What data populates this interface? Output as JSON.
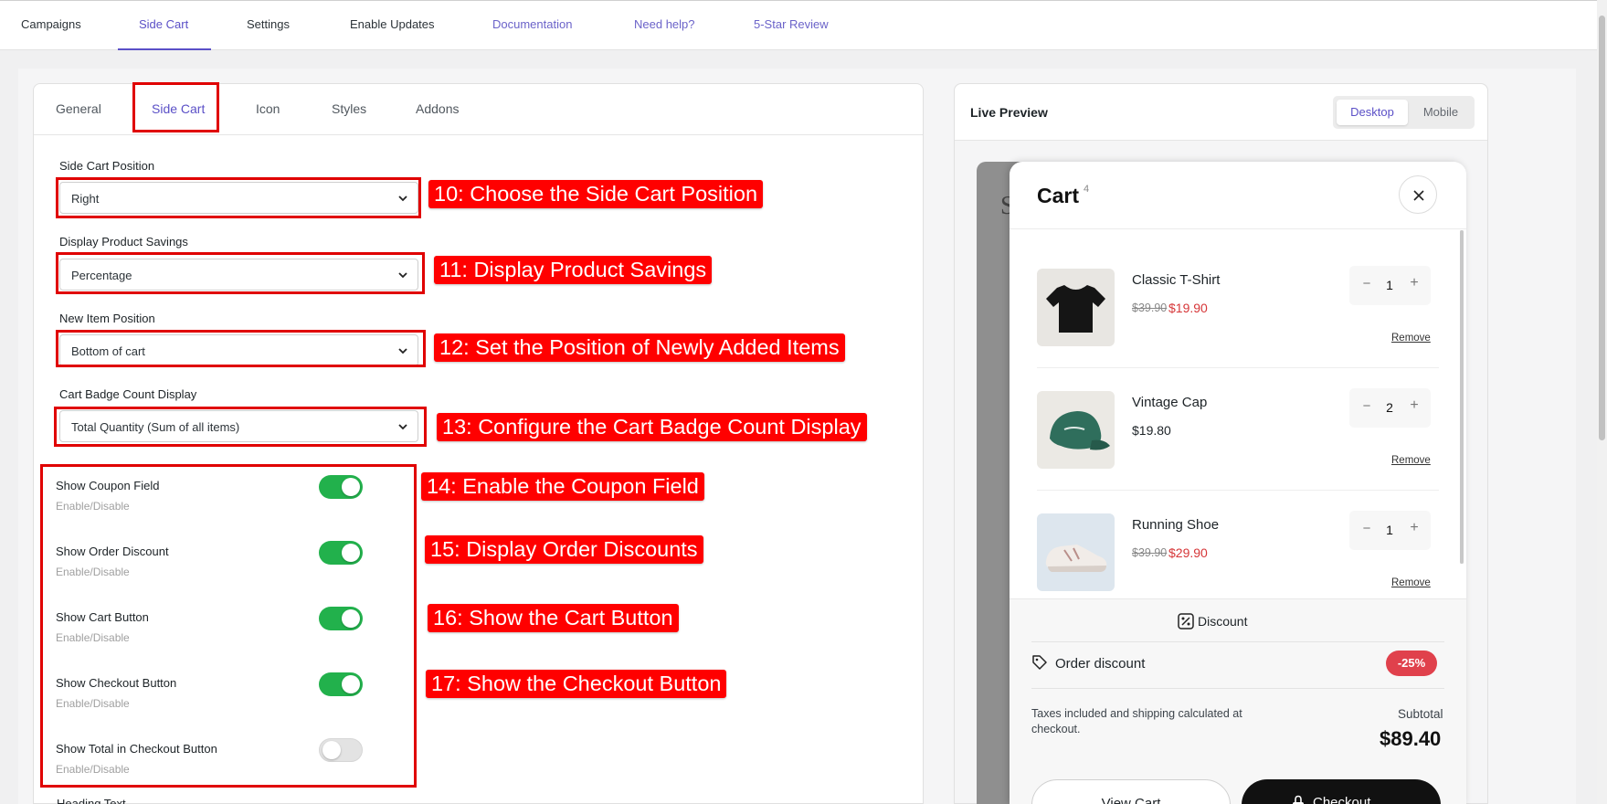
{
  "top_nav": [
    {
      "label": "Campaigns",
      "state": "normal"
    },
    {
      "label": "Side Cart",
      "state": "active"
    },
    {
      "label": "Settings",
      "state": "normal"
    },
    {
      "label": "Enable Updates",
      "state": "normal"
    },
    {
      "label": "Documentation",
      "state": "link"
    },
    {
      "label": "Need help?",
      "state": "link"
    },
    {
      "label": "5-Star Review",
      "state": "link"
    }
  ],
  "tabs": [
    {
      "label": "General"
    },
    {
      "label": "Side Cart",
      "active": true
    },
    {
      "label": "Icon"
    },
    {
      "label": "Styles"
    },
    {
      "label": "Addons"
    }
  ],
  "fields": {
    "position": {
      "label": "Side Cart Position",
      "value": "Right"
    },
    "savings": {
      "label": "Display Product Savings",
      "value": "Percentage"
    },
    "new_item": {
      "label": "New Item Position",
      "value": "Bottom of cart"
    },
    "badge": {
      "label": "Cart Badge Count Display",
      "value": "Total Quantity (Sum of all items)"
    }
  },
  "toggles": [
    {
      "label": "Show Coupon Field",
      "sub": "Enable/Disable",
      "on": true
    },
    {
      "label": "Show Order Discount",
      "sub": "Enable/Disable",
      "on": true
    },
    {
      "label": "Show Cart Button",
      "sub": "Enable/Disable",
      "on": true
    },
    {
      "label": "Show Checkout Button",
      "sub": "Enable/Disable",
      "on": true
    },
    {
      "label": "Show Total in Checkout Button",
      "sub": "Enable/Disable",
      "on": false
    }
  ],
  "next_heading": "Heading Text",
  "annotations": [
    "10: Choose the Side Cart Position",
    "11: Display Product Savings",
    "12: Set the Position of Newly Added Items",
    "13: Configure the Cart Badge Count Display",
    "14: Enable the Coupon Field",
    "15: Display Order Discounts",
    "16: Show the Cart Button",
    "17: Show the Checkout Button"
  ],
  "preview": {
    "title": "Live Preview",
    "modes": [
      "Desktop",
      "Mobile"
    ],
    "active_mode": "Desktop",
    "backdrop_glyph": "S",
    "cart": {
      "title": "Cart",
      "count": "4",
      "items": [
        {
          "name": "Classic T-Shirt",
          "old_price": "$39.90",
          "price": "$19.90",
          "qty": "1",
          "remove": "Remove",
          "thumb": "tshirt"
        },
        {
          "name": "Vintage Cap",
          "old_price": "",
          "price": "$19.80",
          "qty": "2",
          "remove": "Remove",
          "thumb": "cap"
        },
        {
          "name": "Running Shoe",
          "old_price": "$39.90",
          "price": "$29.90",
          "qty": "1",
          "remove": "Remove",
          "thumb": "shoe"
        }
      ],
      "discount_label": "Discount",
      "order_discount_label": "Order discount",
      "order_discount_value": "-25%",
      "tax_note": "Taxes included and shipping calculated at checkout.",
      "subtotal_label": "Subtotal",
      "subtotal_value": "$89.40",
      "view_cart_label": "View Cart",
      "checkout_label": "Checkout"
    }
  },
  "colors": {
    "accent": "#5b50c7",
    "toggle_on": "#22b14c",
    "annotation": "#ff0000",
    "sale_price": "#d63638",
    "discount_badge": "#e0414c"
  }
}
